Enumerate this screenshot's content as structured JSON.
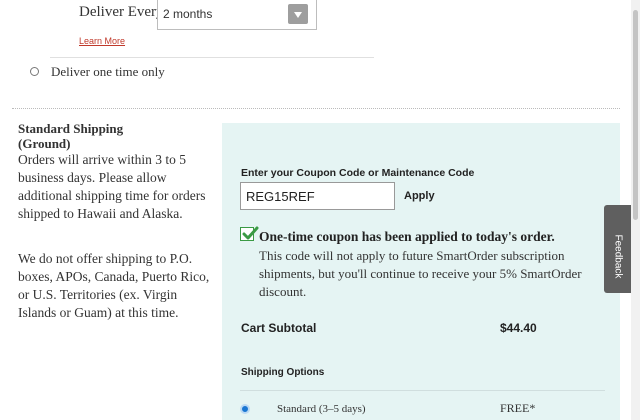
{
  "delivery": {
    "deliver_every_label": "Deliver Every",
    "frequency_value": "2 months",
    "learn_more": "Learn More",
    "one_time_label": "Deliver one time only"
  },
  "shipping_info": {
    "title": "Standard Shipping (Ground)",
    "para1": "Orders will arrive within 3 to 5 business days. Please allow additional shipping time for orders shipped to Hawaii and Alaska.",
    "para2": "We do not offer shipping to P.O. boxes, APOs, Canada, Puerto Rico, or U.S. Territories (ex. Virgin Islands or Guam) at this time."
  },
  "coupon": {
    "label": "Enter your Coupon Code or Maintenance Code",
    "value": "REG15REF",
    "apply_label": "Apply",
    "message_title": "One-time coupon has been applied to today's order.",
    "message_body": "This code will not apply to future SmartOrder subscription shipments, but you'll continue to receive your 5% SmartOrder discount."
  },
  "cart": {
    "subtotal_label": "Cart Subtotal",
    "subtotal_value": "$44.40"
  },
  "shipping_options": {
    "label": "Shipping Options",
    "options": [
      {
        "label": "Standard (3–5 days)",
        "price": "FREE*",
        "selected": true
      }
    ]
  },
  "feedback": {
    "label": "Feedback"
  },
  "colors": {
    "panel_bg": "#e5f4f3",
    "link": "#c0392b",
    "check_green": "#3a9a44",
    "radio_blue": "#1976d2",
    "feedback_bg": "#5f5f5f"
  }
}
